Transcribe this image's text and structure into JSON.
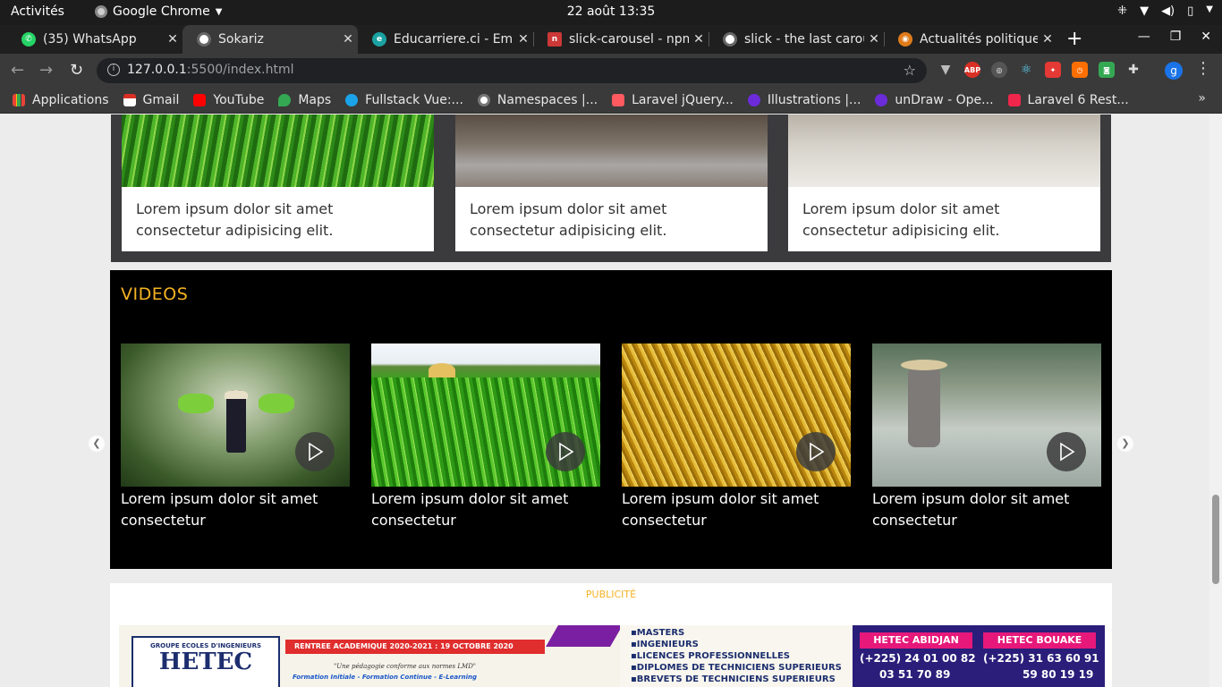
{
  "topbar": {
    "activities": "Activités",
    "app_name": "Google Chrome",
    "clock": "22 août  13:35"
  },
  "tabs": [
    {
      "label": "(35) WhatsApp",
      "icon": "whatsapp-icon",
      "color": "#25d366"
    },
    {
      "label": "Sokariz",
      "icon": "globe-icon",
      "color": "#888888",
      "active": true
    },
    {
      "label": "Educarriere.ci - Emp",
      "icon": "educarriere-icon",
      "color": "#1ba1a1"
    },
    {
      "label": "slick-carousel - npm",
      "icon": "npm-icon",
      "color": "#cb3837"
    },
    {
      "label": "slick - the last carou",
      "icon": "globe-icon",
      "color": "#888888"
    },
    {
      "label": "Actualités politique",
      "icon": "news-icon",
      "color": "#e07b1a"
    }
  ],
  "toolbar": {
    "url_host": "127.0.0.1",
    "url_rest": ":5500/index.html",
    "profile_initial": "g"
  },
  "bookmarks": [
    {
      "label": "Applications",
      "color": "#ea4335"
    },
    {
      "label": "Gmail",
      "color": "#d93025"
    },
    {
      "label": "YouTube",
      "color": "#ff0000"
    },
    {
      "label": "Maps",
      "color": "#34a853"
    },
    {
      "label": "Fullstack Vue:...",
      "color": "#1aa3e8"
    },
    {
      "label": "Namespaces |...",
      "color": "#9e9e9e"
    },
    {
      "label": "Laravel jQuery...",
      "color": "#ff5a5f"
    },
    {
      "label": "Illustrations |...",
      "color": "#6c2bd9"
    },
    {
      "label": "unDraw - Ope...",
      "color": "#6c2bd9"
    },
    {
      "label": "Laravel 6 Rest...",
      "color": "#f0264d"
    }
  ],
  "news": {
    "cards": [
      {
        "text": "Lorem ipsum dolor sit amet consectetur adipisicing elit."
      },
      {
        "text": "Lorem ipsum dolor sit amet consectetur adipisicing elit."
      },
      {
        "text": "Lorem ipsum dolor sit amet consectetur adipisicing elit."
      }
    ]
  },
  "videos": {
    "title": "VIDEOS",
    "items": [
      {
        "caption": "Lorem ipsum dolor sit amet consectetur"
      },
      {
        "caption": "Lorem ipsum dolor sit amet consectetur"
      },
      {
        "caption": "Lorem ipsum dolor sit amet consectetur"
      },
      {
        "caption": "Lorem ipsum dolor sit amet consectetur"
      }
    ]
  },
  "publicite": {
    "label": "PUBLICITÉ",
    "banner": {
      "group": "GROUPE ECOLES D'INGENIEURS",
      "brand": "HETEC",
      "rentree": "RENTREE ACADEMIQUE 2020-2021 : 19 OCTOBRE 2020",
      "slogan": "\"Une pédagogie conforme aux normes LMD\"",
      "formation": "Formation Initiale - Formation Continue - E-Learning",
      "programs": [
        "MASTERS",
        "INGENIEURS",
        "LICENCES PROFESSIONNELLES",
        "DIPLOMES DE TECHNICIENS SUPERIEURS",
        "BREVETS DE TECHNICIENS SUPERIEURS"
      ],
      "abidjan_title": "HETEC ABIDJAN",
      "abidjan_phone1": "(+225) 24 01 00 82",
      "abidjan_phone2": "03 51 70 89",
      "bouake_title": "HETEC BOUAKE",
      "bouake_phone1": "(+225) 31 63 60 91",
      "bouake_phone2": "59 80 19 19"
    }
  }
}
